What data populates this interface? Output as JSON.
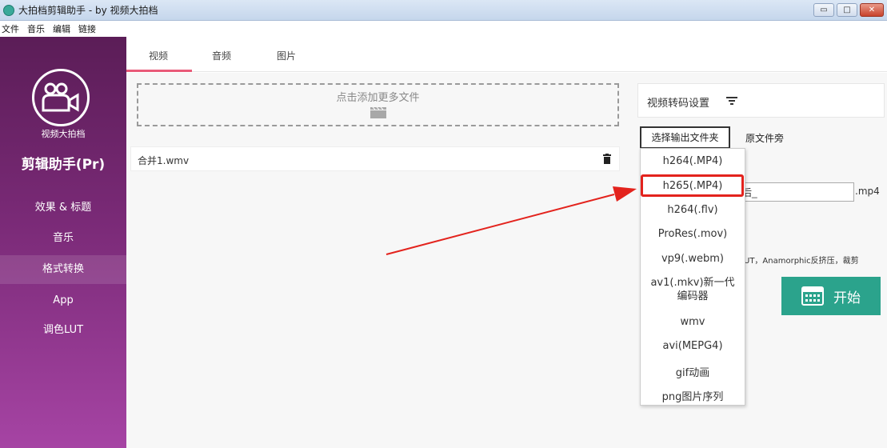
{
  "window": {
    "title": "大拍档剪辑助手 - by 视频大拍档",
    "buttons": [
      "▭",
      "□",
      "✕"
    ]
  },
  "menu": [
    "文件",
    "音乐",
    "编辑",
    "链接"
  ],
  "sidebar": {
    "brand_small": "视频大拍档",
    "brand_big": "剪辑助手(Pr)",
    "items": [
      {
        "label": "效果 & 标题"
      },
      {
        "label": "音乐"
      },
      {
        "label": "格式转换"
      },
      {
        "label": "App"
      },
      {
        "label": "调色LUT"
      }
    ],
    "gradient": [
      "#5b1d57",
      "#a644a4"
    ]
  },
  "tabs": [
    {
      "label": "视频"
    },
    {
      "label": "音频"
    },
    {
      "label": "图片"
    }
  ],
  "dropzone": {
    "text": "点击添加更多文件"
  },
  "files": [
    {
      "name": "合并1.wmv"
    }
  ],
  "settings": {
    "title": "视频转码设置",
    "choose_folder": "选择输出文件夹",
    "original_side": "原文件旁",
    "suffix_value": "后_",
    "extension": ".mp4",
    "notes": "UT，Anamorphic反挤压，裁剪",
    "start_label": "开始"
  },
  "format_dropdown": {
    "options": [
      "h264(.MP4)",
      "h265(.MP4)",
      "h264(.flv)",
      "ProRes(.mov)",
      "vp9(.webm)",
      "av1(.mkv)新一代编码器",
      "wmv",
      "avi(MEPG4)",
      "gif动画",
      "png图片序列"
    ],
    "av1_line1": "av1(.mkv)新一代",
    "av1_line2": "编码器",
    "highlighted": "h265(.MP4)"
  },
  "colors": {
    "accent_tab": "#e95a78",
    "start_button": "#2ba38c",
    "highlight": "#e3231d"
  }
}
